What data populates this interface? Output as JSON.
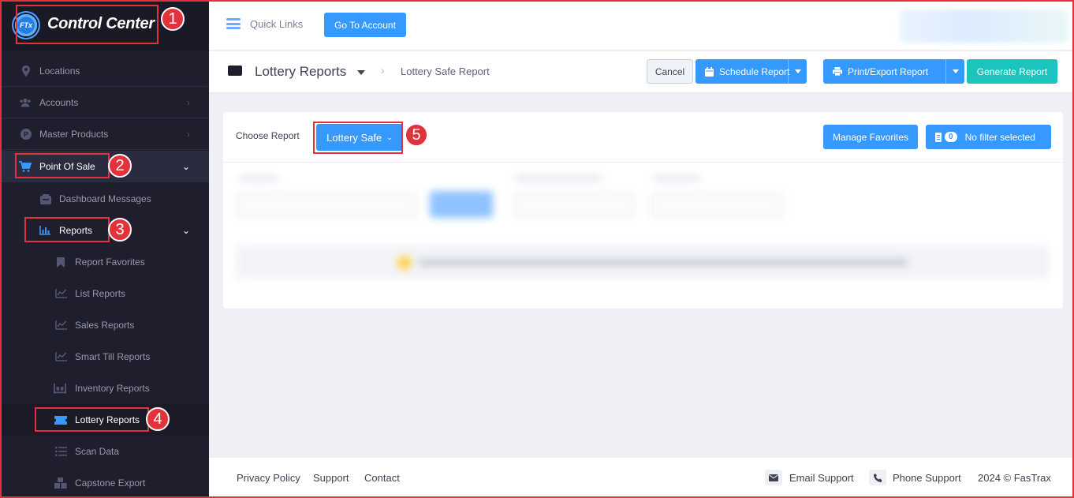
{
  "brand": {
    "name": "Control Center",
    "logo_text": "FTx"
  },
  "sidebar": {
    "items": [
      {
        "label": "Locations",
        "icon": "map-pin-icon"
      },
      {
        "label": "Accounts",
        "icon": "users-icon"
      },
      {
        "label": "Master Products",
        "icon": "product-icon"
      },
      {
        "label": "Point Of Sale",
        "icon": "cart-icon"
      },
      {
        "label": "Dashboard Messages",
        "icon": "message-box-icon"
      },
      {
        "label": "Reports",
        "icon": "bar-chart-icon"
      },
      {
        "label": "Report Favorites",
        "icon": "bookmark-icon"
      },
      {
        "label": "List Reports",
        "icon": "line-chart-icon"
      },
      {
        "label": "Sales Reports",
        "icon": "line-chart-icon"
      },
      {
        "label": "Smart Till Reports",
        "icon": "line-chart-icon"
      },
      {
        "label": "Inventory Reports",
        "icon": "inventory-icon"
      },
      {
        "label": "Lottery Reports",
        "icon": "ticket-icon"
      },
      {
        "label": "Scan Data",
        "icon": "list-icon"
      },
      {
        "label": "Capstone Export",
        "icon": "boxes-icon"
      }
    ]
  },
  "callouts": [
    "1",
    "2",
    "3",
    "4",
    "5"
  ],
  "topbar": {
    "quick_links": "Quick Links",
    "go_to_account": "Go To Account"
  },
  "subheader": {
    "title": "Lottery Reports",
    "breadcrumb": "Lottery Safe Report",
    "cancel": "Cancel",
    "schedule": "Schedule Report",
    "print_export": "Print/Export Report",
    "generate": "Generate Report"
  },
  "card": {
    "choose_label": "Choose Report",
    "selected_report": "Lottery Safe",
    "manage_favorites": "Manage Favorites",
    "filter_count": "0",
    "filter_label": "No filter selected"
  },
  "footer": {
    "privacy": "Privacy Policy",
    "support": "Support",
    "contact": "Contact",
    "email_support": "Email Support",
    "phone_support": "Phone Support",
    "copyright": "2024 © FasTrax"
  },
  "colors": {
    "accent": "#3699ff",
    "teal": "#1bc5bd",
    "sidebar": "#1e1e2d",
    "callout": "#e2323c"
  }
}
